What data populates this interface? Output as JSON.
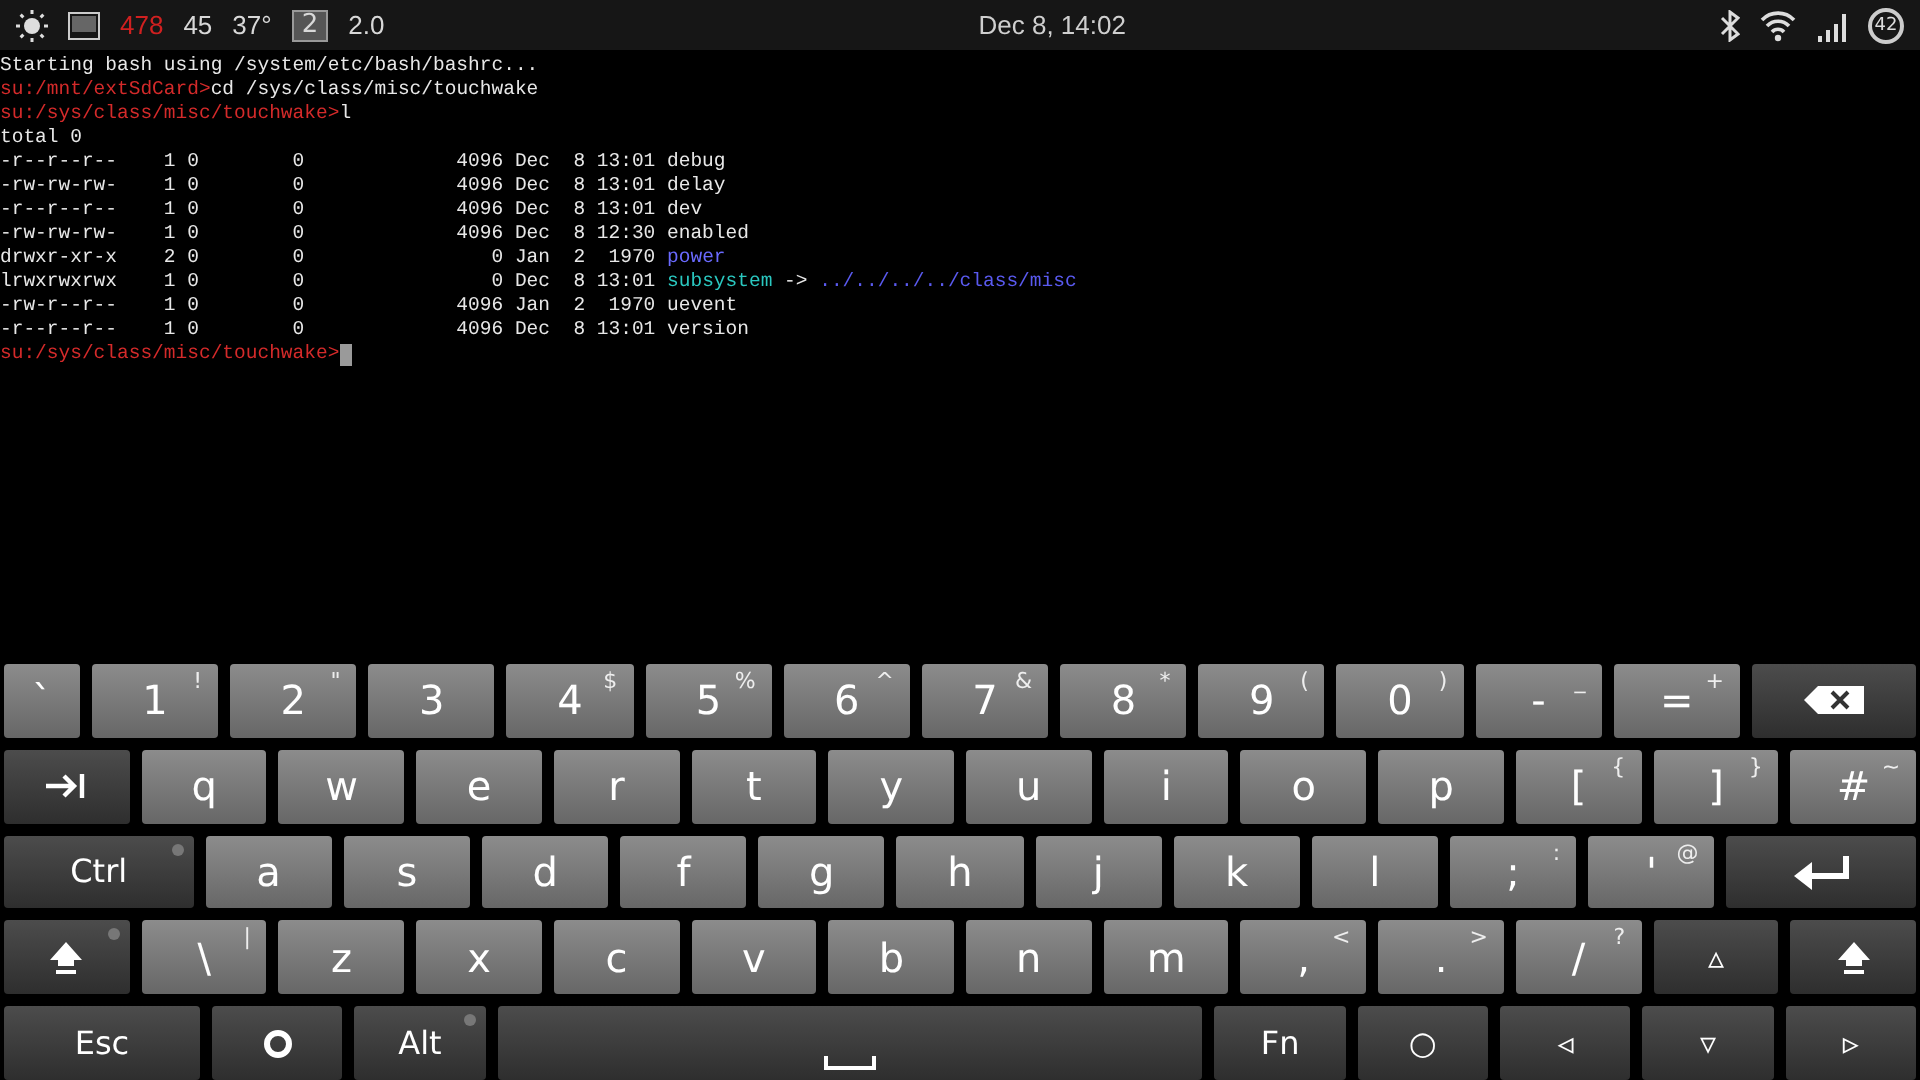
{
  "status_bar": {
    "left_items": [
      {
        "kind": "brightness"
      },
      {
        "kind": "screenshot"
      },
      {
        "kind": "text",
        "text": "478",
        "color": "#d02020"
      },
      {
        "kind": "text",
        "text": "45",
        "color": "#d8d8d8"
      },
      {
        "kind": "text",
        "text": "37°",
        "color": "#d8d8d8"
      },
      {
        "kind": "boxed",
        "text": "2"
      },
      {
        "kind": "text",
        "text": "2.0",
        "color": "#d8d8d8"
      }
    ],
    "clock": "Dec 8, 14:02",
    "right_items": [
      {
        "kind": "bluetooth"
      },
      {
        "kind": "wifi"
      },
      {
        "kind": "signal"
      },
      {
        "kind": "battery",
        "text": "42"
      }
    ]
  },
  "terminal": {
    "lines": [
      [
        {
          "text": "Starting bash using /system/etc/bash/bashrc...",
          "color": "#e8e8e8"
        }
      ],
      [
        {
          "text": "su:/mnt/extSdCard>",
          "color": "#d42a2a"
        },
        {
          "text": "cd /sys/class/misc/touchwake",
          "color": "#e8e8e8"
        }
      ],
      [
        {
          "text": "su:/sys/class/misc/touchwake>",
          "color": "#d42a2a"
        },
        {
          "text": "l",
          "color": "#e8e8e8"
        }
      ],
      [
        {
          "text": "total 0",
          "color": "#e8e8e8"
        }
      ],
      [
        {
          "text": "-r--r--r--    1 0        0             4096 Dec  8 13:01 debug",
          "color": "#e8e8e8"
        }
      ],
      [
        {
          "text": "-rw-rw-rw-    1 0        0             4096 Dec  8 13:01 delay",
          "color": "#e8e8e8"
        }
      ],
      [
        {
          "text": "-r--r--r--    1 0        0             4096 Dec  8 13:01 dev",
          "color": "#e8e8e8"
        }
      ],
      [
        {
          "text": "-rw-rw-rw-    1 0        0             4096 Dec  8 12:30 enabled",
          "color": "#e8e8e8"
        }
      ],
      [
        {
          "text": "drwxr-xr-x    2 0        0                0 Jan  2  1970 ",
          "color": "#e8e8e8"
        },
        {
          "text": "power",
          "color": "#6a6aff"
        }
      ],
      [
        {
          "text": "lrwxrwxrwx    1 0        0                0 Dec  8 13:01 ",
          "color": "#e8e8e8"
        },
        {
          "text": "subsystem",
          "color": "#2ac8c0"
        },
        {
          "text": " -> ",
          "color": "#e8e8e8"
        },
        {
          "text": "../../../../class/misc",
          "color": "#5a5af0"
        }
      ],
      [
        {
          "text": "-rw-r--r--    1 0        0             4096 Jan  2  1970 uevent",
          "color": "#e8e8e8"
        }
      ],
      [
        {
          "text": "-r--r--r--    1 0        0             4096 Dec  8 13:01 version",
          "color": "#e8e8e8"
        }
      ],
      [
        {
          "text": "su:/sys/class/misc/touchwake>",
          "color": "#d42a2a"
        }
      ]
    ],
    "cursor": true
  },
  "keyboard": {
    "rows": [
      {
        "keys": [
          {
            "kind": "narrow",
            "label": "`"
          },
          {
            "kind": "char",
            "label": "1",
            "alt": "!"
          },
          {
            "kind": "char",
            "label": "2",
            "alt": "\""
          },
          {
            "kind": "char",
            "label": "3"
          },
          {
            "kind": "char",
            "label": "4",
            "alt": "$"
          },
          {
            "kind": "char",
            "label": "5",
            "alt": "%"
          },
          {
            "kind": "char",
            "label": "6",
            "alt": "^"
          },
          {
            "kind": "char",
            "label": "7",
            "alt": "&"
          },
          {
            "kind": "char",
            "label": "8",
            "alt": "*"
          },
          {
            "kind": "char",
            "label": "9",
            "alt": "("
          },
          {
            "kind": "char",
            "label": "0",
            "alt": ")"
          },
          {
            "kind": "char",
            "label": "-",
            "alt": "_"
          },
          {
            "kind": "char",
            "label": "=",
            "alt": "+"
          },
          {
            "kind": "backspace"
          }
        ]
      },
      {
        "keys": [
          {
            "kind": "tab"
          },
          {
            "kind": "char",
            "label": "q"
          },
          {
            "kind": "char",
            "label": "w"
          },
          {
            "kind": "char",
            "label": "e"
          },
          {
            "kind": "char",
            "label": "r"
          },
          {
            "kind": "char",
            "label": "t"
          },
          {
            "kind": "char",
            "label": "y"
          },
          {
            "kind": "char",
            "label": "u"
          },
          {
            "kind": "char",
            "label": "i"
          },
          {
            "kind": "char",
            "label": "o"
          },
          {
            "kind": "char",
            "label": "p"
          },
          {
            "kind": "char",
            "label": "[",
            "alt": "{"
          },
          {
            "kind": "char",
            "label": "]",
            "alt": "}"
          },
          {
            "kind": "char",
            "label": "#",
            "alt": "~"
          }
        ]
      },
      {
        "keys": [
          {
            "kind": "wide",
            "label": "Ctrl",
            "sticky": true
          },
          {
            "kind": "char",
            "label": "a"
          },
          {
            "kind": "char",
            "label": "s"
          },
          {
            "kind": "char",
            "label": "d"
          },
          {
            "kind": "char",
            "label": "f"
          },
          {
            "kind": "char",
            "label": "g"
          },
          {
            "kind": "char",
            "label": "h"
          },
          {
            "kind": "char",
            "label": "j"
          },
          {
            "kind": "char",
            "label": "k"
          },
          {
            "kind": "char",
            "label": "l"
          },
          {
            "kind": "char",
            "label": ";",
            "alt": ":"
          },
          {
            "kind": "char",
            "label": "'",
            "alt": "@"
          },
          {
            "kind": "enter"
          }
        ]
      },
      {
        "keys": [
          {
            "kind": "shift",
            "sticky": true
          },
          {
            "kind": "char",
            "label": "\\",
            "alt": "|"
          },
          {
            "kind": "char",
            "label": "z"
          },
          {
            "kind": "char",
            "label": "x"
          },
          {
            "kind": "char",
            "label": "c"
          },
          {
            "kind": "char",
            "label": "v"
          },
          {
            "kind": "char",
            "label": "b"
          },
          {
            "kind": "char",
            "label": "n"
          },
          {
            "kind": "char",
            "label": "m"
          },
          {
            "kind": "char",
            "label": ",",
            "alt": "<"
          },
          {
            "kind": "char",
            "label": ".",
            "alt": ">"
          },
          {
            "kind": "char",
            "label": "/",
            "alt": "?"
          },
          {
            "kind": "mod",
            "label": "▵"
          },
          {
            "kind": "shift"
          }
        ]
      },
      {
        "keys": [
          {
            "kind": "wide",
            "label": "Esc"
          },
          {
            "kind": "settings"
          },
          {
            "kind": "mod",
            "label": "Alt",
            "sticky": true
          },
          {
            "kind": "space"
          },
          {
            "kind": "mod",
            "label": "Fn"
          },
          {
            "kind": "mod",
            "label": "○"
          },
          {
            "kind": "mod",
            "label": "◃"
          },
          {
            "kind": "mod",
            "label": "▿"
          },
          {
            "kind": "mod",
            "label": "▹"
          }
        ]
      }
    ]
  }
}
